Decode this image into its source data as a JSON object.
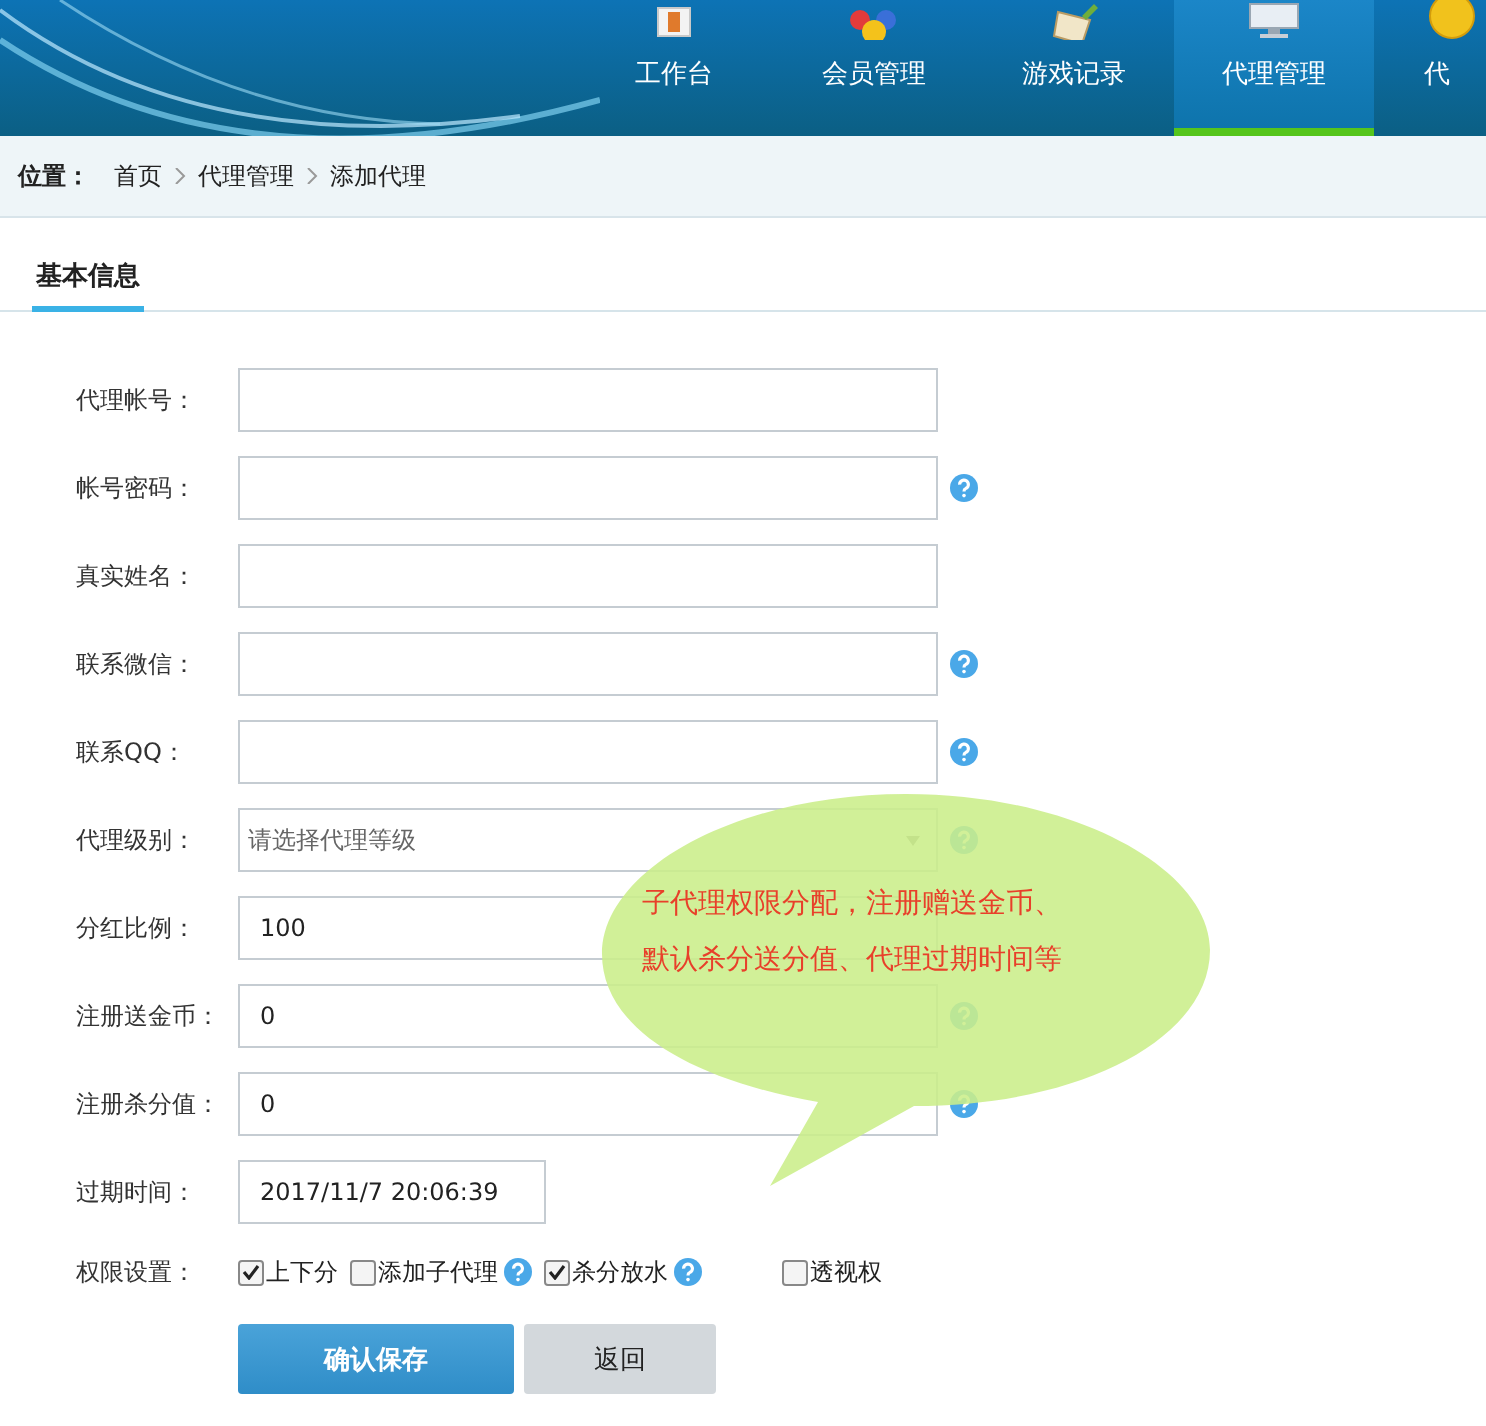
{
  "nav": {
    "items": [
      {
        "label": "工作台",
        "selected": false
      },
      {
        "label": "会员管理",
        "selected": false
      },
      {
        "label": "游戏记录",
        "selected": false
      },
      {
        "label": "代理管理",
        "selected": true
      },
      {
        "label": "代",
        "selected": false
      }
    ]
  },
  "breadcrumb": {
    "label": "位置：",
    "items": [
      "首页",
      "代理管理",
      "添加代理"
    ]
  },
  "section_tab": "基本信息",
  "fields": [
    {
      "kind": "text",
      "label": "代理帐号：",
      "help": false
    },
    {
      "kind": "text",
      "label": "帐号密码：",
      "help": true
    },
    {
      "kind": "text",
      "label": "真实姓名：",
      "help": false
    },
    {
      "kind": "text",
      "label": "联系微信：",
      "help": true
    },
    {
      "kind": "text",
      "label": "联系QQ：",
      "help": true
    },
    {
      "kind": "select",
      "label": "代理级别：",
      "placeholder": "请选择代理等级",
      "help": true
    },
    {
      "kind": "text",
      "label": "分红比例：",
      "value": "100",
      "help": false
    },
    {
      "kind": "text",
      "label": "注册送金币：",
      "value": "0",
      "help": true
    },
    {
      "kind": "text",
      "label": "注册杀分值：",
      "value": "0",
      "help": true
    },
    {
      "kind": "date",
      "label": "过期时间：",
      "value": "2017/11/7 20:06:39",
      "help": false
    }
  ],
  "permissions": {
    "label": "权限设置：",
    "items": [
      {
        "label": "上下分",
        "checked": true,
        "help": false
      },
      {
        "label": "添加子代理",
        "checked": false,
        "help": true
      },
      {
        "label": "杀分放水",
        "checked": true,
        "help": true
      },
      {
        "label": "透视权",
        "checked": false,
        "help": false
      }
    ]
  },
  "buttons": [
    {
      "kind": "primary",
      "label": "确认保存"
    },
    {
      "kind": "secondary",
      "label": "返回"
    }
  ],
  "callout": {
    "lines": [
      "子代理权限分配，注册赠送金币、",
      "默认杀分送分值、代理过期时间等"
    ]
  }
}
